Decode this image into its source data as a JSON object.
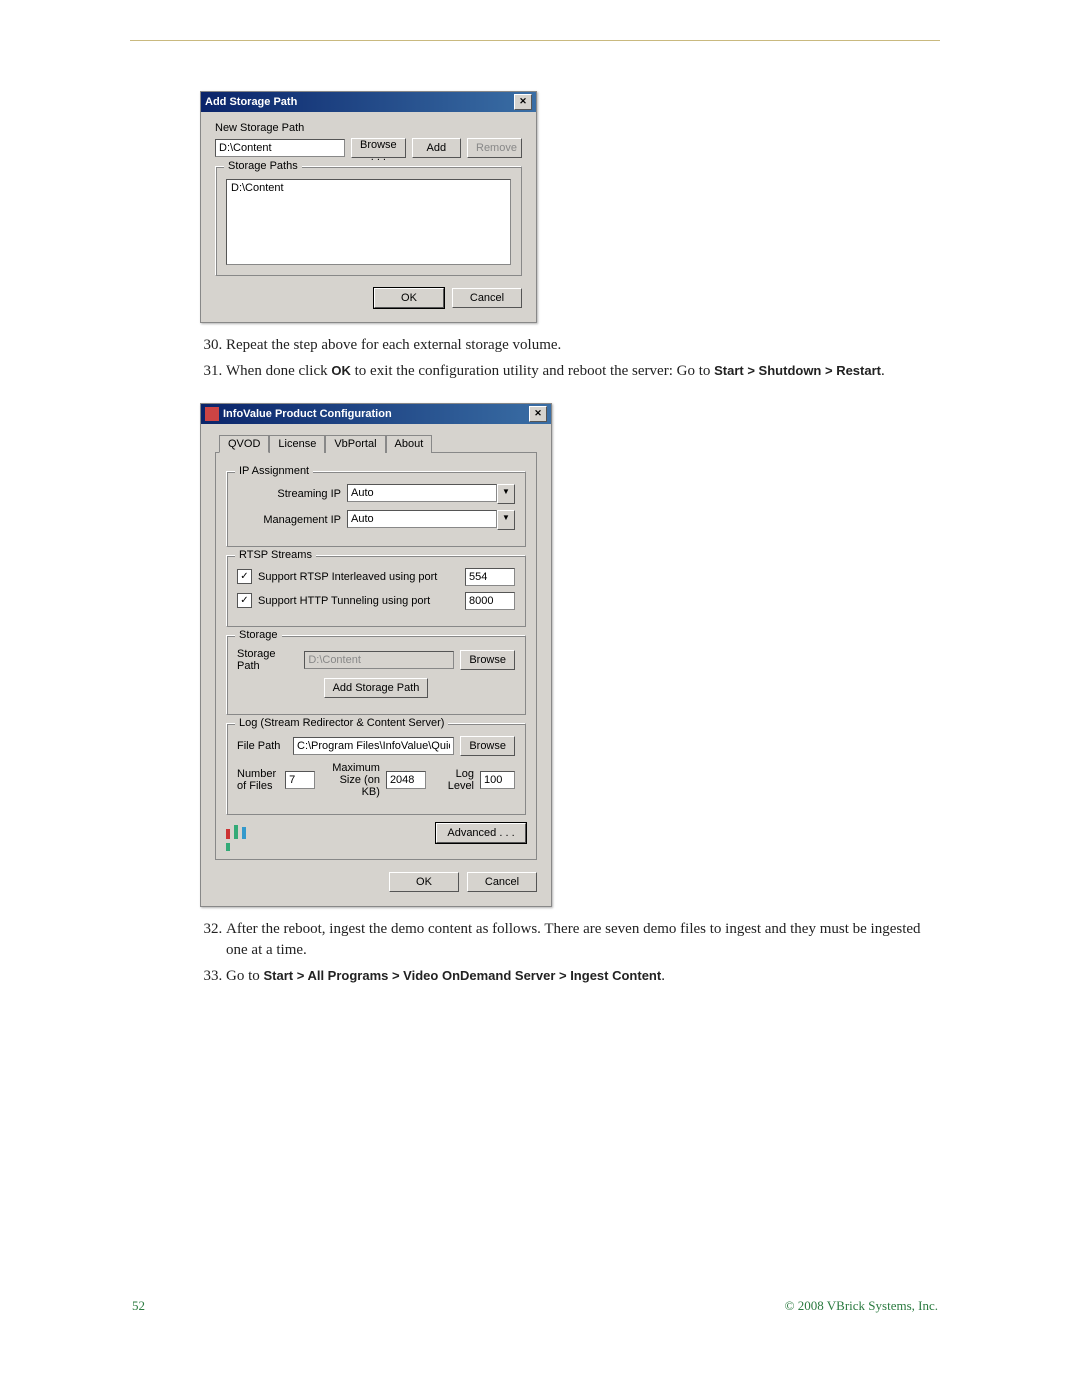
{
  "dialog1": {
    "title": "Add Storage Path",
    "newPathLabel": "New Storage Path",
    "newPathValue": "D:\\Content",
    "browse": "Browse . . .",
    "add": "Add",
    "remove": "Remove",
    "storagePathsLabel": "Storage Paths",
    "listItem": "D:\\Content",
    "ok": "OK",
    "cancel": "Cancel"
  },
  "steps1": {
    "s30": "Repeat the step above for each external storage volume.",
    "s31a": "When done click ",
    "s31b": "OK",
    "s31c": " to exit the configuration utility and reboot the server: Go to ",
    "s31d": "Start > Shutdown > Restart",
    "s31e": "."
  },
  "dialog2": {
    "title": "InfoValue Product Configuration",
    "tabs": {
      "qvod": "QVOD",
      "license": "License",
      "vbportal": "VbPortal",
      "about": "About"
    },
    "ip": {
      "legend": "IP Assignment",
      "streamingLabel": "Streaming IP",
      "streamingValue": "Auto",
      "mgmtLabel": "Management IP",
      "mgmtValue": "Auto"
    },
    "rtsp": {
      "legend": "RTSP Streams",
      "chk1": "Support RTSP Interleaved using port",
      "port1": "554",
      "chk2": "Support HTTP Tunneling using port",
      "port2": "8000"
    },
    "storage": {
      "legend": "Storage",
      "pathLabel": "Storage Path",
      "pathValue": "D:\\Content",
      "browse": "Browse",
      "addBtn": "Add Storage Path"
    },
    "log": {
      "legend": "Log (Stream Redirector & Content Server)",
      "filePathLabel": "File Path",
      "filePathValue": "C:\\Program Files\\InfoValue\\QuickVideo OnDemand Se",
      "browse": "Browse",
      "numFilesLabel": "Number of Files",
      "numFilesValue": "7",
      "maxSizeLabel": "Maximum Size (on KB)",
      "maxSizeValue": "2048",
      "logLevelLabel": "Log Level",
      "logLevelValue": "100"
    },
    "advanced": "Advanced . . .",
    "ok": "OK",
    "cancel": "Cancel"
  },
  "steps2": {
    "s32": "After the reboot, ingest the demo content as follows. There are seven demo files to ingest and they must be ingested one at a time.",
    "s33a": "Go to ",
    "s33b": "Start > All Programs > Video OnDemand Server > Ingest Content",
    "s33c": "."
  },
  "footer": {
    "page": "52",
    "copyright": "© 2008 VBrick Systems, Inc."
  }
}
